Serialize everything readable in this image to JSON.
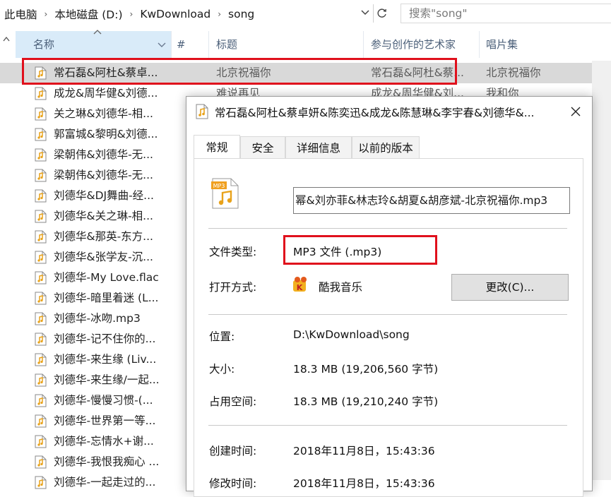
{
  "address": {
    "crumbs": [
      "此电脑",
      "本地磁盘 (D:)",
      "KwDownload",
      "song"
    ],
    "separator": "›",
    "dropdown_icon": "chevron-down-icon",
    "refresh_icon": "refresh-icon",
    "search_placeholder": "搜索\"song\""
  },
  "columns": {
    "name": "名称",
    "number": "#",
    "title": "标题",
    "artist": "参与创作的艺术家",
    "album": "唱片集"
  },
  "files": [
    {
      "name": "常石磊&阿杜&蔡卓...",
      "title": "北京祝福你",
      "artist": "常石磊&阿杜&蔡...",
      "album": "北京祝福你",
      "selected": true
    },
    {
      "name": "成龙&周华健&刘德...",
      "title": "难说再见",
      "artist": "成龙&周华健&刘...",
      "album": "我和你"
    },
    {
      "name": "关之琳&刘德华-相..."
    },
    {
      "name": "郭富城&黎明&刘德..."
    },
    {
      "name": "梁朝伟&刘德华-无..."
    },
    {
      "name": "梁朝伟&刘德华-无..."
    },
    {
      "name": "刘德华&DJ舞曲-经..."
    },
    {
      "name": "刘德华&关之琳-相..."
    },
    {
      "name": "刘德华&那英-东方..."
    },
    {
      "name": "刘德华&张学友-沉..."
    },
    {
      "name": "刘德华-My Love.flac"
    },
    {
      "name": "刘德华-暗里着迷 (L..."
    },
    {
      "name": "刘德华-冰吻.mp3"
    },
    {
      "name": "刘德华-记不住你的..."
    },
    {
      "name": "刘德华-来生缘 (Liv..."
    },
    {
      "name": "刘德华-来生缘/一起..."
    },
    {
      "name": "刘德华-慢慢习惯-(..."
    },
    {
      "name": "刘德华-世界第一等..."
    },
    {
      "name": "刘德华-忘情水+谢..."
    },
    {
      "name": "刘德华-我恨我痴心 ..."
    },
    {
      "name": "刘德华-一起走过的..."
    }
  ],
  "dialog": {
    "title": "常石磊&阿杜&蔡卓妍&陈奕迅&成龙&陈慧琳&李宇春&刘德华&...",
    "close_icon": "close-icon",
    "tabs": [
      "常规",
      "安全",
      "详细信息",
      "以前的版本"
    ],
    "active_tab": 0,
    "file_icon": "mp3-file-icon",
    "file_icon_text": "MP3",
    "filename": "幂&刘亦菲&林志玲&胡夏&胡彦斌-北京祝福你.mp3",
    "type_label": "文件类型:",
    "type_value": "MP3 文件 (.mp3)",
    "open_label": "打开方式:",
    "open_value": "酷我音乐",
    "open_icon": "kuwo-music-icon",
    "change_button": "更改(C)...",
    "location_label": "位置:",
    "location_value": "D:\\KwDownload\\song",
    "size_label": "大小:",
    "size_value": "18.3 MB (19,206,560 字节)",
    "disk_label": "占用空间:",
    "disk_value": "18.3 MB (19,210,240 字节)",
    "created_label": "创建时间:",
    "created_value": "2018年11月8日，15:43:36",
    "modified_label": "修改时间:",
    "modified_value": "2018年11月8日，15:43:36"
  },
  "colors": {
    "highlight_box": "#e0101c",
    "header_text": "#4c607a",
    "sorted_column_bg": "#d9ebf9"
  }
}
